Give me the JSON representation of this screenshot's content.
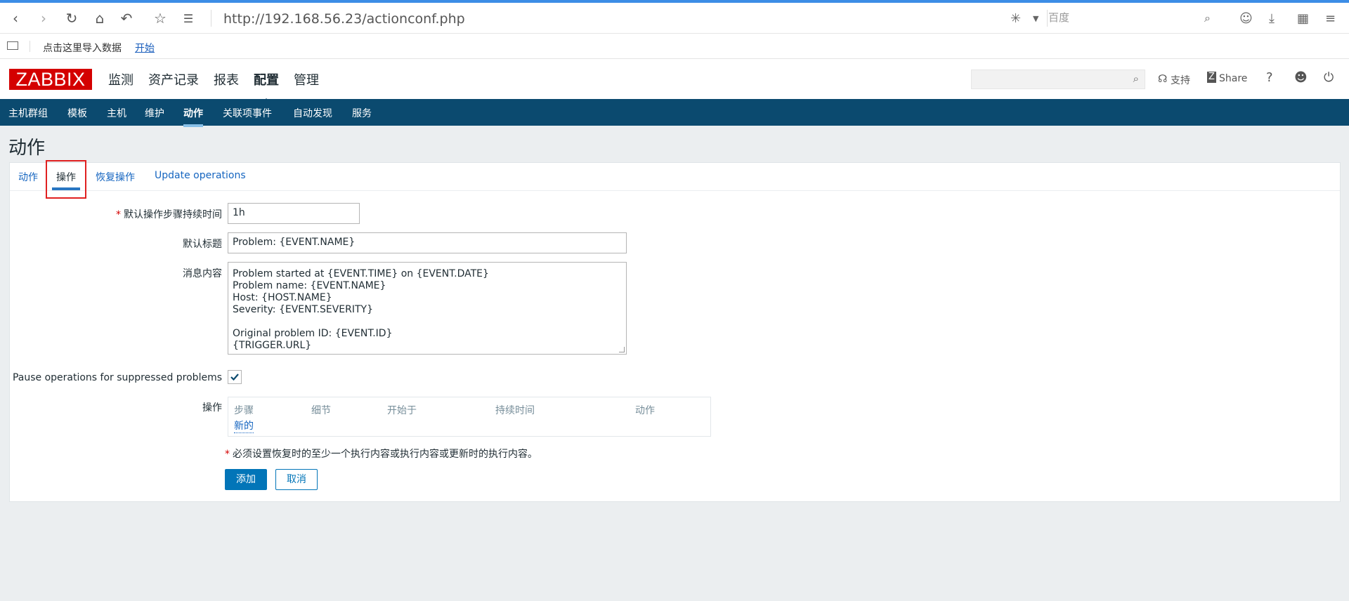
{
  "browser": {
    "url": "http://192.168.56.23/actionconf.php",
    "search_placeholder": "百度",
    "bookmark_text": "点击这里导入数据",
    "bookmark_link": "开始"
  },
  "header": {
    "logo": "ZABBIX",
    "menu": [
      "监测",
      "资产记录",
      "报表",
      "配置",
      "管理"
    ],
    "active_menu": "配置",
    "support": "支持",
    "share": "Share",
    "help": "?"
  },
  "subnav": [
    "主机群组",
    "模板",
    "主机",
    "维护",
    "动作",
    "关联项事件",
    "自动发现",
    "服务"
  ],
  "page": {
    "title": "动作",
    "tabs": [
      "动作",
      "操作",
      "恢复操作",
      "Update operations"
    ],
    "active_tab": "操作"
  },
  "form": {
    "step_duration_label": "默认操作步骤持续时间",
    "step_duration_value": "1h",
    "subject_label": "默认标题",
    "subject_value": "Problem: {EVENT.NAME}",
    "message_label": "消息内容",
    "message_value": "Problem started at {EVENT.TIME} on {EVENT.DATE}\nProblem name: {EVENT.NAME}\nHost: {HOST.NAME}\nSeverity: {EVENT.SEVERITY}\n\nOriginal problem ID: {EVENT.ID}\n{TRIGGER.URL}",
    "pause_label": "Pause operations for suppressed problems",
    "pause_checked": true,
    "operations_label": "操作",
    "operations_columns": [
      "步骤",
      "细节",
      "开始于",
      "持续时间",
      "动作"
    ],
    "operations_new": "新的",
    "note": "必须设置恢复时的至少一个执行内容或执行内容或更新时的执行内容。",
    "add_button": "添加",
    "cancel_button": "取消"
  },
  "colors": {
    "accent": "#0275b8",
    "subnav_bg": "#0b4a6f",
    "logo_bg": "#d40000",
    "highlight": "#e02020"
  }
}
